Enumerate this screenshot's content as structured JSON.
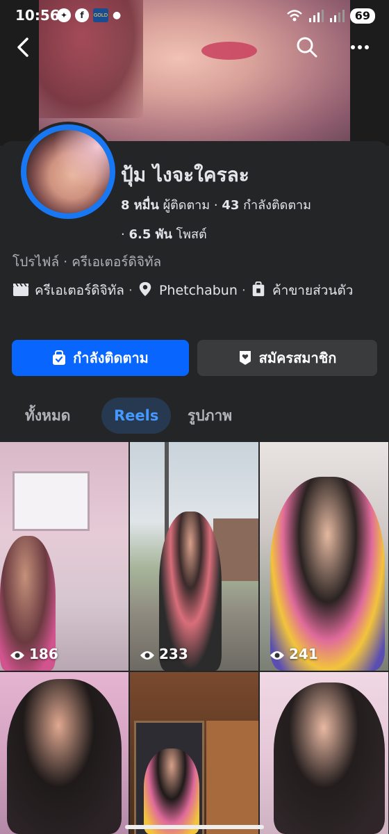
{
  "status_bar": {
    "time": "10:56",
    "battery": "69",
    "gold_badge": "GOLD"
  },
  "header": {
    "back_icon": "chevron-left-icon",
    "search_icon": "search-icon",
    "more_icon": "more-horizontal-icon"
  },
  "profile": {
    "name": "ปุ้ม ไงจะใครละ",
    "followers_count": "8 หมื่น",
    "followers_label": "ผู้ติดตาม",
    "following_count": "43",
    "following_label": "กำลังติดตาม",
    "posts_count": "6.5 พัน",
    "posts_label": "โพสต์",
    "category": "โปรไฟล์ · ครีเอเตอร์ดิจิทัล",
    "detail_creator": "ครีเอเตอร์ดิจิทัล",
    "detail_location": "Phetchabun",
    "detail_seller": "ค้าขายส่วนตัว"
  },
  "actions": {
    "following_button": "กำลังติดตาม",
    "subscribe_button": "สมัครสมาชิก"
  },
  "tabs": [
    {
      "label": "ทั้งหมด",
      "active": false
    },
    {
      "label": "Reels",
      "active": true
    },
    {
      "label": "รูปภาพ",
      "active": false
    }
  ],
  "reels": [
    {
      "views": "186"
    },
    {
      "views": "233"
    },
    {
      "views": "241"
    },
    {
      "views": ""
    },
    {
      "views": ""
    },
    {
      "views": ""
    }
  ],
  "colors": {
    "background": "#242526",
    "accent": "#0866ff",
    "tab_active_bg": "#263951",
    "tab_active_text": "#4599ff"
  }
}
